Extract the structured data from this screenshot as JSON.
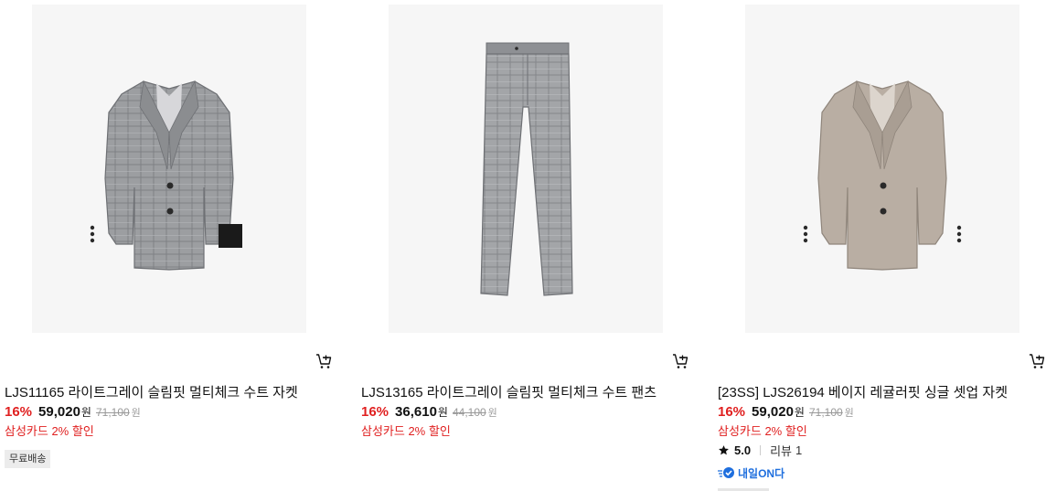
{
  "products": [
    {
      "name": "LJS11165 라이트그레이 슬림핏 멀티체크 수트 자켓",
      "discount": "16%",
      "price": "59,020",
      "currency": "원",
      "original_price": "71,100",
      "original_currency": "원",
      "card_benefit": "삼성카드 2% 할인",
      "badge": "무료배송",
      "image_icon": "gray-check-suit-jacket",
      "cart_icon": "cart-plus-icon"
    },
    {
      "name": "LJS13165 라이트그레이 슬림핏 멀티체크 수트 팬츠",
      "discount": "16%",
      "price": "36,610",
      "currency": "원",
      "original_price": "44,100",
      "original_currency": "원",
      "card_benefit": "삼성카드 2% 할인",
      "image_icon": "gray-check-suit-pants",
      "cart_icon": "cart-plus-icon"
    },
    {
      "name": "[23SS] LJS26194 베이지 레귤러핏 싱글 셋업 자켓",
      "discount": "16%",
      "price": "59,020",
      "currency": "원",
      "original_price": "71,100",
      "original_currency": "원",
      "card_benefit": "삼성카드 2% 할인",
      "rating": "5.0",
      "review_label": "리뷰",
      "review_count": "1",
      "delivery_label": "내일ON다",
      "image_icon": "beige-setup-jacket",
      "cart_icon": "cart-plus-icon"
    }
  ],
  "colors": {
    "discount": "#e02020",
    "benefit": "#e02020",
    "delivery": "#1f6fde",
    "thumb_bg": "#f6f6f6"
  }
}
